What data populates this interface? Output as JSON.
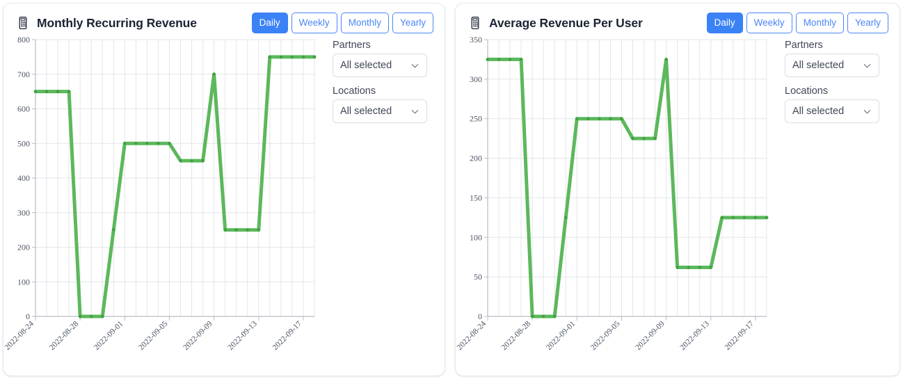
{
  "panels": [
    {
      "id": "mrr",
      "icon": "calculator-icon",
      "title": "Monthly Recurring Revenue",
      "buttons": [
        {
          "label": "Daily",
          "active": true
        },
        {
          "label": "Weekly",
          "active": false
        },
        {
          "label": "Monthly",
          "active": false
        },
        {
          "label": "Yearly",
          "active": false
        }
      ],
      "filters": [
        {
          "label": "Partners",
          "value": "All selected"
        },
        {
          "label": "Locations",
          "value": "All selected"
        }
      ]
    },
    {
      "id": "arpu",
      "icon": "calculator-icon",
      "title": "Average Revenue Per User",
      "buttons": [
        {
          "label": "Daily",
          "active": true
        },
        {
          "label": "Weekly",
          "active": false
        },
        {
          "label": "Monthly",
          "active": false
        },
        {
          "label": "Yearly",
          "active": false
        }
      ],
      "filters": [
        {
          "label": "Partners",
          "value": "All selected"
        },
        {
          "label": "Locations",
          "value": "All selected"
        }
      ]
    }
  ],
  "colors": {
    "series_green": "#5cb85c",
    "accent_blue": "#3b82f6",
    "accent_blue_border": "#4a86f7",
    "grid": "#e3e5e9",
    "axis": "#b8bcc4",
    "text": "#4b5563"
  },
  "chart_data": [
    {
      "type": "line",
      "title": "Monthly Recurring Revenue",
      "xlabel": "",
      "ylabel": "",
      "ylim": [
        0,
        800
      ],
      "yticks": [
        0,
        100,
        200,
        300,
        400,
        500,
        600,
        700,
        800
      ],
      "xtick_labels": [
        "2022-08-24",
        "2022-08-28",
        "2022-09-01",
        "2022-09-05",
        "2022-09-09",
        "2022-09-13",
        "2022-09-17"
      ],
      "xtick_indices": [
        0,
        4,
        8,
        12,
        16,
        20,
        24
      ],
      "grid": true,
      "legend": "none",
      "x": [
        "2022-08-24",
        "2022-08-25",
        "2022-08-26",
        "2022-08-27",
        "2022-08-28",
        "2022-08-29",
        "2022-08-30",
        "2022-08-31",
        "2022-09-01",
        "2022-09-02",
        "2022-09-03",
        "2022-09-04",
        "2022-09-05",
        "2022-09-06",
        "2022-09-07",
        "2022-09-08",
        "2022-09-09",
        "2022-09-10",
        "2022-09-11",
        "2022-09-12",
        "2022-09-13",
        "2022-09-14",
        "2022-09-15",
        "2022-09-16",
        "2022-09-17",
        "2022-09-18"
      ],
      "values": [
        650,
        650,
        650,
        650,
        0,
        0,
        0,
        250,
        500,
        500,
        500,
        500,
        500,
        450,
        450,
        450,
        700,
        250,
        250,
        250,
        250,
        750,
        750,
        750,
        750,
        750
      ]
    },
    {
      "type": "line",
      "title": "Average Revenue Per User",
      "xlabel": "",
      "ylabel": "",
      "ylim": [
        0,
        350
      ],
      "yticks": [
        0,
        50,
        100,
        150,
        200,
        250,
        300,
        350
      ],
      "xtick_labels": [
        "2022-08-24",
        "2022-08-28",
        "2022-09-01",
        "2022-09-05",
        "2022-09-09",
        "2022-09-13",
        "2022-09-17"
      ],
      "xtick_indices": [
        0,
        4,
        8,
        12,
        16,
        20,
        24
      ],
      "grid": true,
      "legend": "none",
      "x": [
        "2022-08-24",
        "2022-08-25",
        "2022-08-26",
        "2022-08-27",
        "2022-08-28",
        "2022-08-29",
        "2022-08-30",
        "2022-08-31",
        "2022-09-01",
        "2022-09-02",
        "2022-09-03",
        "2022-09-04",
        "2022-09-05",
        "2022-09-06",
        "2022-09-07",
        "2022-09-08",
        "2022-09-09",
        "2022-09-10",
        "2022-09-11",
        "2022-09-12",
        "2022-09-13",
        "2022-09-14",
        "2022-09-15",
        "2022-09-16",
        "2022-09-17",
        "2022-09-18"
      ],
      "values": [
        325,
        325,
        325,
        325,
        0,
        0,
        0,
        125,
        250,
        250,
        250,
        250,
        250,
        225,
        225,
        225,
        325,
        62,
        62,
        62,
        62,
        125,
        125,
        125,
        125,
        125
      ]
    }
  ]
}
